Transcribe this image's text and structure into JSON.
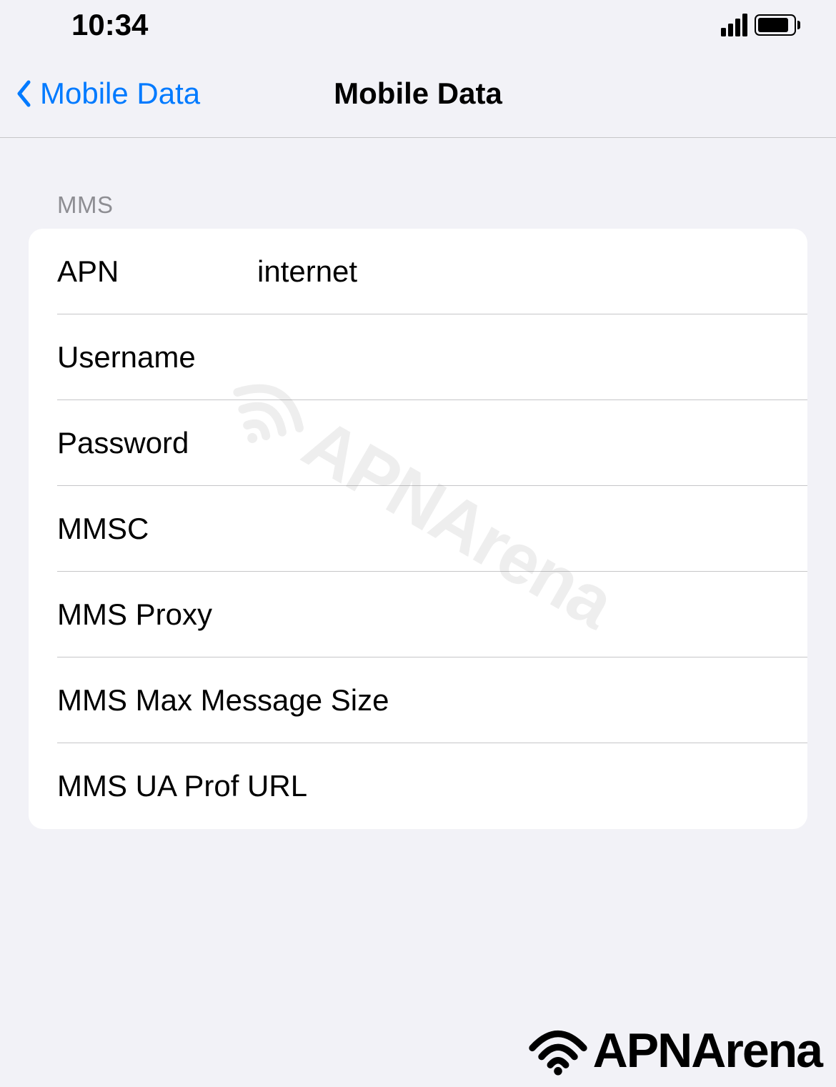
{
  "status": {
    "time": "10:34"
  },
  "nav": {
    "back_label": "Mobile Data",
    "title": "Mobile Data"
  },
  "section_header": "MMS",
  "rows": {
    "apn": {
      "label": "APN",
      "value": "internet"
    },
    "username": {
      "label": "Username",
      "value": ""
    },
    "password": {
      "label": "Password",
      "value": ""
    },
    "mmsc": {
      "label": "MMSC",
      "value": ""
    },
    "mms_proxy": {
      "label": "MMS Proxy",
      "value": ""
    },
    "mms_max_size": {
      "label": "MMS Max Message Size",
      "value": ""
    },
    "mms_ua_prof": {
      "label": "MMS UA Prof URL",
      "value": ""
    }
  },
  "watermark": "APNArena",
  "footer_brand": "APNArena"
}
